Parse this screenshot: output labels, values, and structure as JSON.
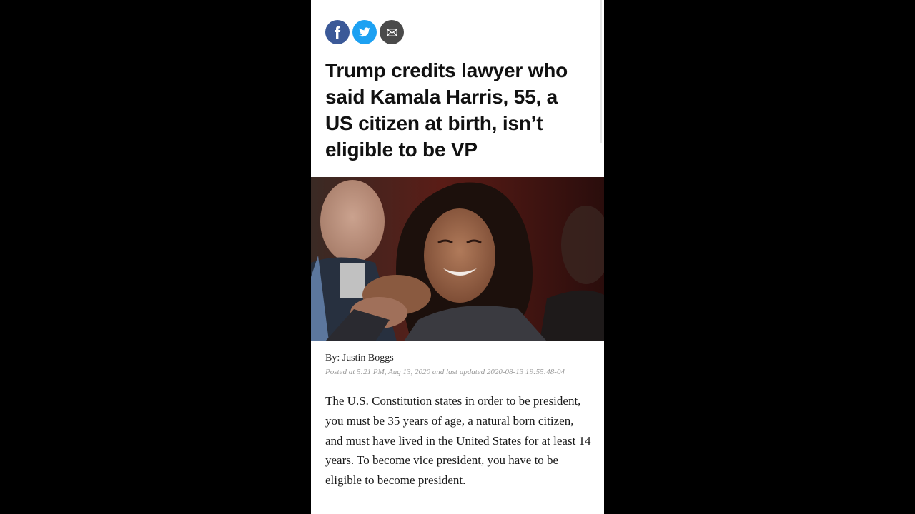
{
  "share": {
    "facebook_icon": "facebook-icon",
    "twitter_icon": "twitter-icon",
    "email_icon": "email-icon",
    "colors": {
      "facebook": "#3b5998",
      "twitter": "#1da1f2",
      "email": "#4a4a4a"
    }
  },
  "article": {
    "headline": "Trump credits lawyer who said Kamala Harris, 55, a US citizen at birth, isn’t eligible to be VP",
    "byline": "By: Justin Boggs",
    "posted": "Posted at 5:21 PM, Aug 13, 2020 and last updated 2020-08-13 19:55:48-04",
    "body": "The U.S. Constitution states in order to be president, you must be 35 years of age, a natural born citizen, and must have lived in the United States for at least 14 years. To become vice president, you have to be eligible to become president."
  }
}
